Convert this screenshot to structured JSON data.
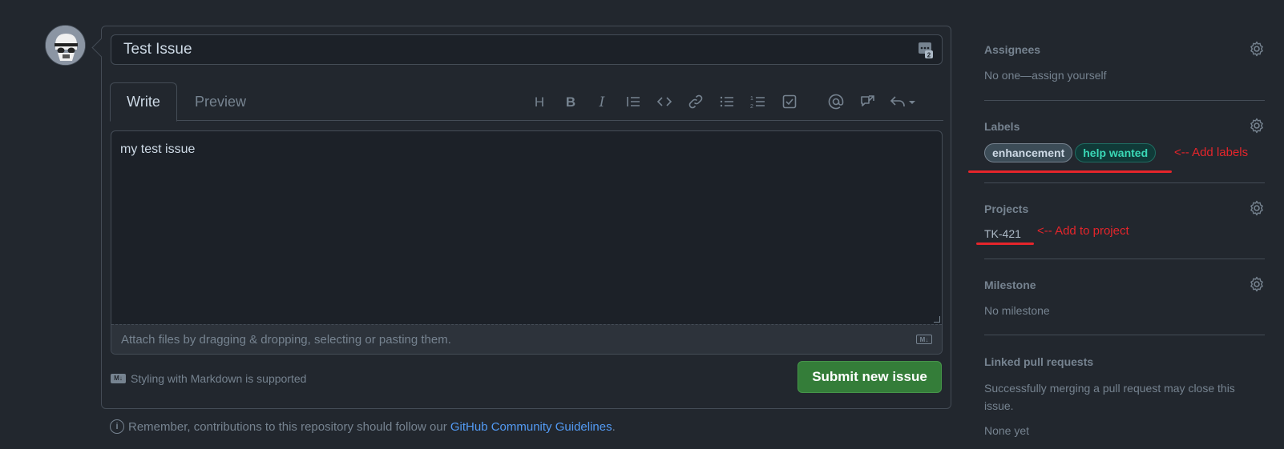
{
  "issue": {
    "title": "Test Issue",
    "body": "my test issue"
  },
  "tabs": {
    "write": "Write",
    "preview": "Preview"
  },
  "toolbar": {
    "heading": "H",
    "bold": "B",
    "italic": "I"
  },
  "editor": {
    "attach_hint": "Attach files by dragging & dropping, selecting or pasting them.",
    "md_badge": "M↓"
  },
  "footer": {
    "markdown_note": "Styling with Markdown is supported",
    "submit_label": "Submit new issue",
    "guidelines_prefix": "Remember, contributions to this repository should follow our ",
    "guidelines_link": "GitHub Community Guidelines",
    "guidelines_suffix": "."
  },
  "sidebar": {
    "assignees": {
      "heading": "Assignees",
      "value": "No one—assign yourself"
    },
    "labels": {
      "heading": "Labels",
      "items": [
        {
          "name": "enhancement",
          "color": "#3c4c57"
        },
        {
          "name": "help wanted",
          "color": "#103a38"
        }
      ]
    },
    "projects": {
      "heading": "Projects",
      "value": "TK-421"
    },
    "milestone": {
      "heading": "Milestone",
      "value": "No milestone"
    },
    "linked_prs": {
      "heading": "Linked pull requests",
      "value": "Successfully merging a pull request may close this issue.",
      "status": "None yet"
    }
  },
  "annotations": {
    "labels": "<-- Add labels",
    "project": "<-- Add to project",
    "color": "#e5252b"
  },
  "colors": {
    "background": "#22272e",
    "submit": "#347d39",
    "link": "#539bf5"
  }
}
